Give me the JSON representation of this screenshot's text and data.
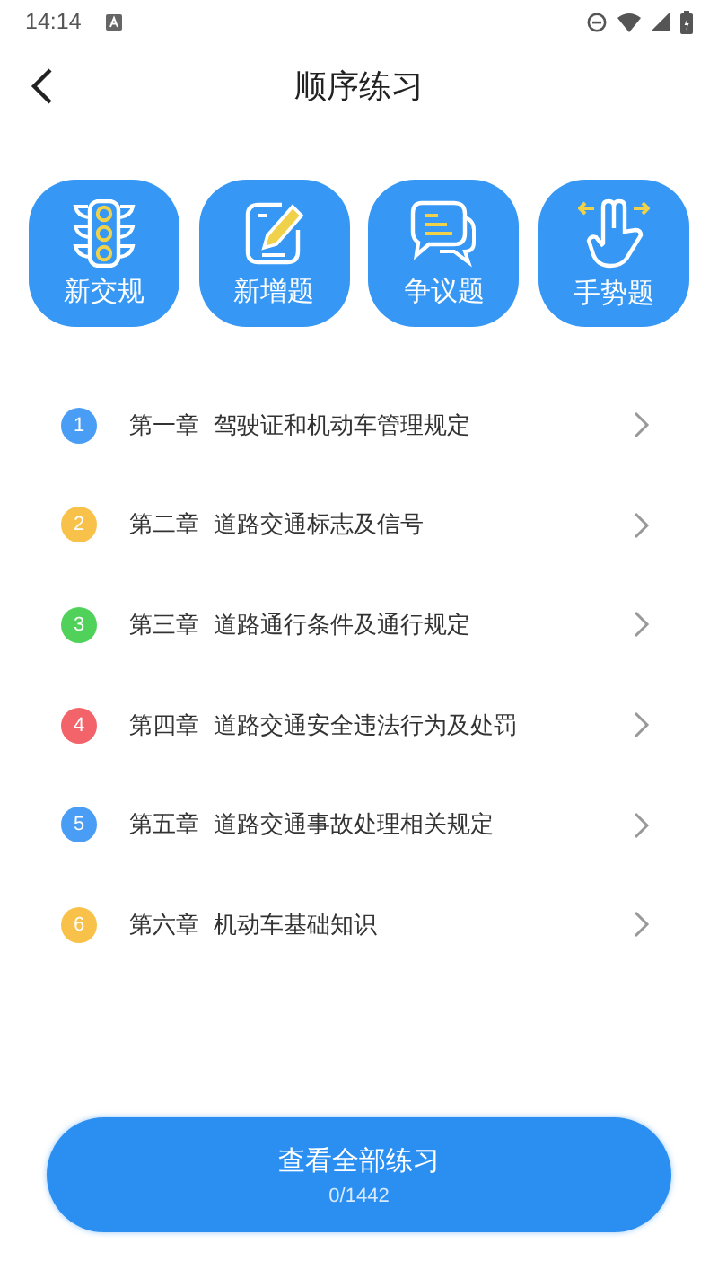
{
  "status_bar": {
    "time": "14:14"
  },
  "header": {
    "title": "顺序练习"
  },
  "categories": [
    {
      "label": "新交规",
      "kind": "traffic-light"
    },
    {
      "label": "新增题",
      "kind": "edit"
    },
    {
      "label": "争议题",
      "kind": "chat"
    },
    {
      "label": "手势题",
      "kind": "gesture"
    }
  ],
  "chapters": [
    {
      "number": "1",
      "chapter": "第一章",
      "title": "驾驶证和机动车管理规定",
      "color": "#4a9df5"
    },
    {
      "number": "2",
      "chapter": "第二章",
      "title": "道路交通标志及信号",
      "color": "#f8c24a"
    },
    {
      "number": "3",
      "chapter": "第三章",
      "title": "道路通行条件及通行规定",
      "color": "#4fd15a"
    },
    {
      "number": "4",
      "chapter": "第四章",
      "title": "道路交通安全违法行为及处罚",
      "color": "#f2646a"
    },
    {
      "number": "5",
      "chapter": "第五章",
      "title": "道路交通事故处理相关规定",
      "color": "#4a9df5"
    },
    {
      "number": "6",
      "chapter": "第六章",
      "title": "机动车基础知识",
      "color": "#f8c24a"
    }
  ],
  "all_button": {
    "label": "查看全部练习",
    "progress": "0/1442"
  }
}
